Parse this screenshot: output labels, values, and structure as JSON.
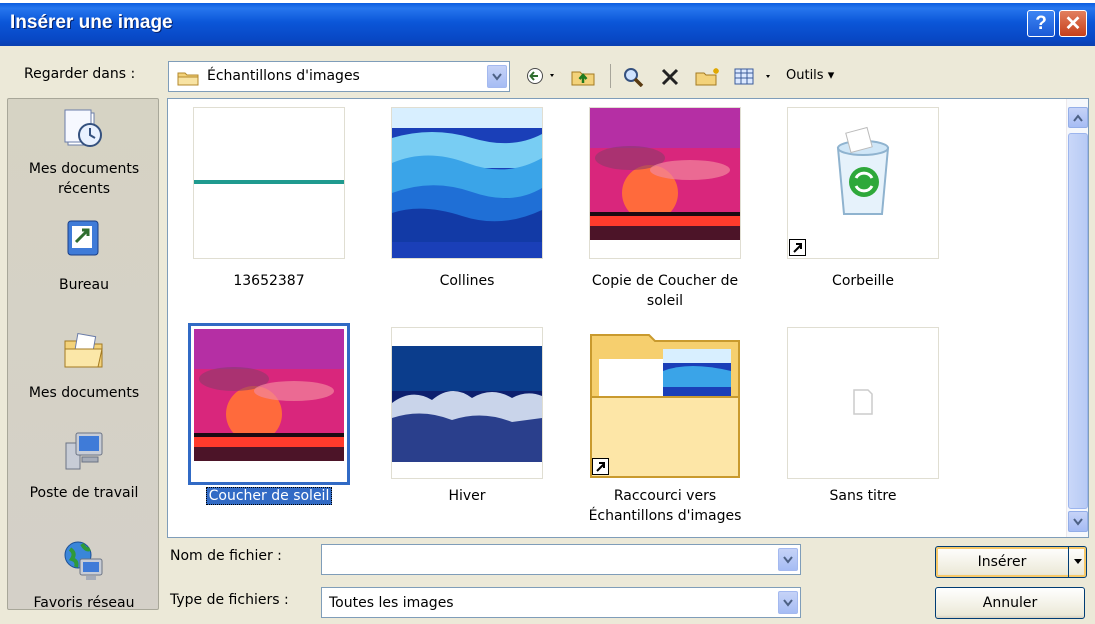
{
  "window": {
    "title": "Insérer une image",
    "help_glyph": "?",
    "close_glyph": "✕"
  },
  "toolbar": {
    "look_in_label": "Regarder dans :",
    "look_in_value": "Échantillons d'images",
    "tools_label": "Outils ▾",
    "icons": [
      "back-icon",
      "up-folder-icon",
      "search-web-icon",
      "delete-icon",
      "new-folder-icon",
      "views-icon"
    ]
  },
  "places": [
    {
      "label": "Mes documents\nrécents",
      "icon": "recent-documents-icon"
    },
    {
      "label": "Bureau",
      "icon": "desktop-icon"
    },
    {
      "label": "Mes documents",
      "icon": "my-documents-icon"
    },
    {
      "label": "Poste de travail",
      "icon": "my-computer-icon"
    },
    {
      "label": "Favoris réseau",
      "icon": "network-places-icon"
    }
  ],
  "files": [
    {
      "name": "13652387",
      "kind": "image-line"
    },
    {
      "name": "Collines",
      "kind": "image-hills"
    },
    {
      "name": "Copie de Coucher de soleil",
      "kind": "image-sunset"
    },
    {
      "name": "Corbeille",
      "kind": "recycle-bin",
      "shortcut": true
    },
    {
      "name": "Coucher de soleil",
      "kind": "image-sunset",
      "selected": true
    },
    {
      "name": "Hiver",
      "kind": "image-winter"
    },
    {
      "name": "Raccourci vers Échantillons d'images",
      "kind": "folder",
      "shortcut": true
    },
    {
      "name": "Sans titre",
      "kind": "blank"
    }
  ],
  "bottom": {
    "filename_label": "Nom de fichier :",
    "filename_value": "",
    "filetype_label": "Type de fichiers :",
    "filetype_value": "Toutes les images",
    "insert_label": "Insérer",
    "cancel_label": "Annuler"
  },
  "colors": {
    "title_blue": "#0b56d8",
    "selection": "#316ac5",
    "dialog_bg": "#ece9d8",
    "teal_line": "#1f9a8f"
  }
}
